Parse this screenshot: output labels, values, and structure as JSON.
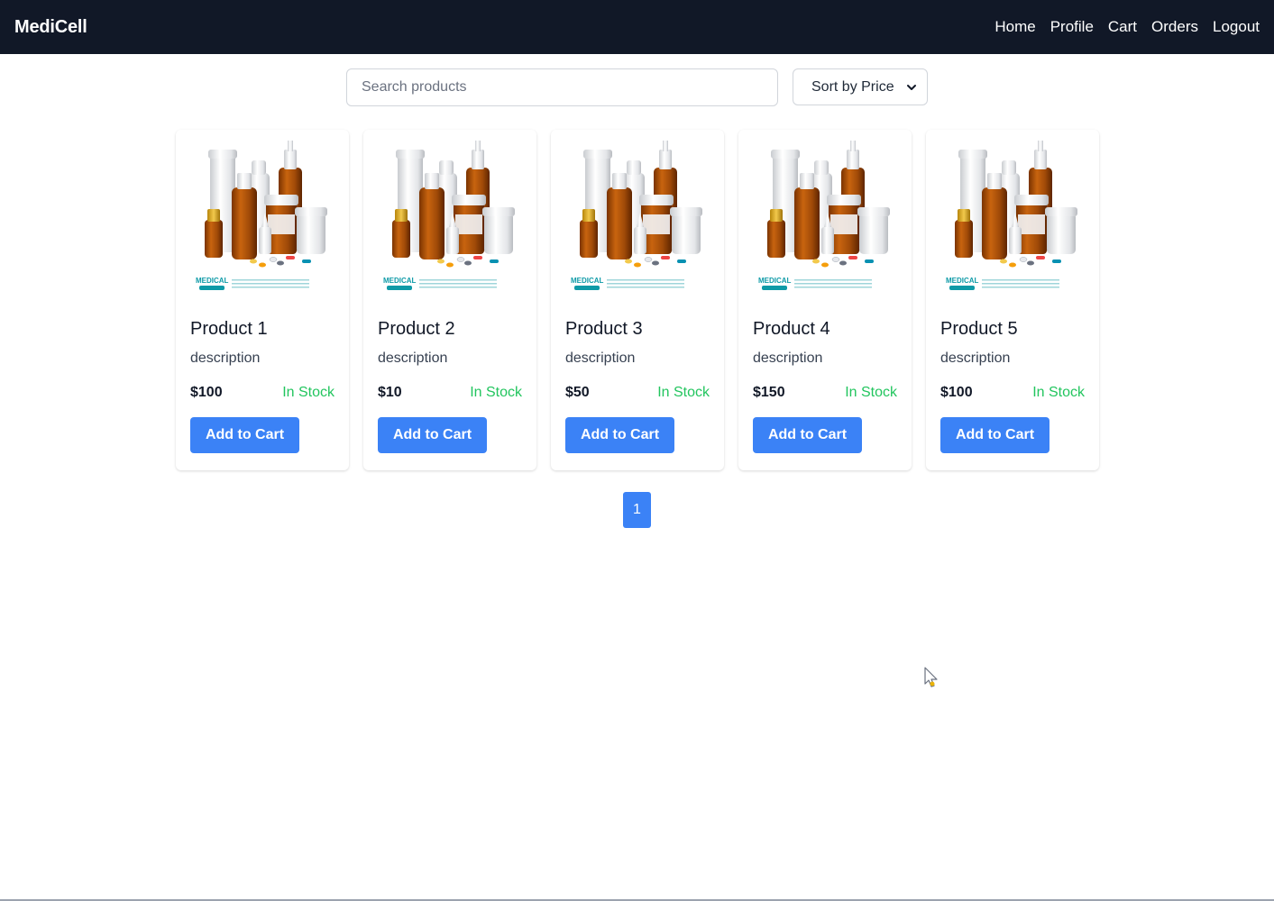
{
  "header": {
    "brand": "MediCell",
    "nav": [
      "Home",
      "Profile",
      "Cart",
      "Orders",
      "Logout"
    ]
  },
  "toolbar": {
    "search_placeholder": "Search products",
    "sort_selected": "Sort by Price"
  },
  "products": [
    {
      "title": "Product 1",
      "description": "description",
      "price": "$100",
      "stock": "In Stock",
      "button": "Add to Cart"
    },
    {
      "title": "Product 2",
      "description": "description",
      "price": "$10",
      "stock": "In Stock",
      "button": "Add to Cart"
    },
    {
      "title": "Product 3",
      "description": "description",
      "price": "$50",
      "stock": "In Stock",
      "button": "Add to Cart"
    },
    {
      "title": "Product 4",
      "description": "description",
      "price": "$150",
      "stock": "In Stock",
      "button": "Add to Cart"
    },
    {
      "title": "Product 5",
      "description": "description",
      "price": "$100",
      "stock": "In Stock",
      "button": "Add to Cart"
    }
  ],
  "image_badge": "MEDICAL",
  "pagination": {
    "current": "1"
  },
  "colors": {
    "navbar_bg": "#111827",
    "accent": "#3b82f6",
    "in_stock": "#22c55e"
  }
}
